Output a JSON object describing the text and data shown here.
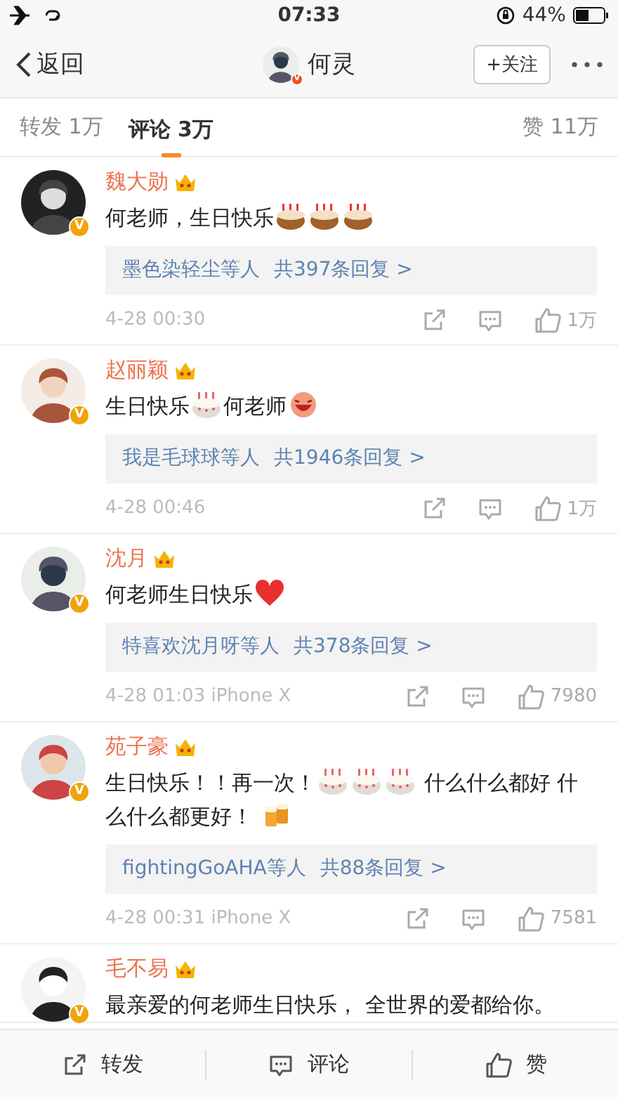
{
  "status_bar": {
    "time": "07:33",
    "battery": "44%"
  },
  "nav": {
    "back": "返回",
    "title": "何灵",
    "follow": "+关注",
    "verified_badge": "V"
  },
  "tabs": [
    {
      "label": "转发 1万",
      "selected": false
    },
    {
      "label": "评论 3万",
      "selected": true
    },
    {
      "label": "赞 11万",
      "selected": false
    }
  ],
  "comments": [
    {
      "name": "魏大勋",
      "verified_badge": "V",
      "content": [
        {
          "kind": "text",
          "text": "何老师，生日快乐"
        },
        {
          "kind": "cake"
        },
        {
          "kind": "cake"
        },
        {
          "kind": "cake"
        }
      ],
      "replies": {
        "who": "墨色染轻尘等人",
        "count": "共397条回复 >"
      },
      "time": "4-28 00:30",
      "likes": "1万"
    },
    {
      "name": "赵丽颖",
      "verified_badge": "V",
      "content": [
        {
          "kind": "text",
          "text": "生日快乐"
        },
        {
          "kind": "white-cake"
        },
        {
          "kind": "text",
          "text": "何老师"
        },
        {
          "kind": "laugh"
        }
      ],
      "replies": {
        "who": "我是毛球球等人",
        "count": "共1946条回复 >"
      },
      "time": "4-28 00:46",
      "likes": "1万"
    },
    {
      "name": "沈月",
      "verified_badge": "V",
      "content": [
        {
          "kind": "text",
          "text": "何老师生日快乐"
        },
        {
          "kind": "heart"
        }
      ],
      "replies": {
        "who": "特喜欢沈月呀等人",
        "count": "共378条回复 >"
      },
      "time": "4-28 01:03 iPhone X",
      "likes": "7980"
    },
    {
      "name": "苑子豪",
      "verified_badge": "V",
      "content": [
        {
          "kind": "text",
          "text": "生日快乐！！再一次！"
        },
        {
          "kind": "white-cake"
        },
        {
          "kind": "white-cake"
        },
        {
          "kind": "white-cake"
        },
        {
          "kind": "text",
          "text": " 什么什么都好 什"
        },
        {
          "kind": "break"
        },
        {
          "kind": "text",
          "text": "么什么都更好！ "
        },
        {
          "kind": "beer"
        }
      ],
      "replies": {
        "who": "fightingGoAHA等人",
        "count": "共88条回复 >"
      },
      "time": "4-28 00:31 iPhone X",
      "likes": "7581"
    },
    {
      "name": "毛不易",
      "verified_badge": "V",
      "content": [
        {
          "kind": "text",
          "text": "最亲爱的何老师生日快乐， 全世界的爱都给你。"
        }
      ]
    }
  ],
  "bottom_bar": [
    {
      "kind": "share",
      "label": "转发"
    },
    {
      "kind": "comment",
      "label": "评论"
    },
    {
      "kind": "like",
      "label": "赞"
    }
  ]
}
